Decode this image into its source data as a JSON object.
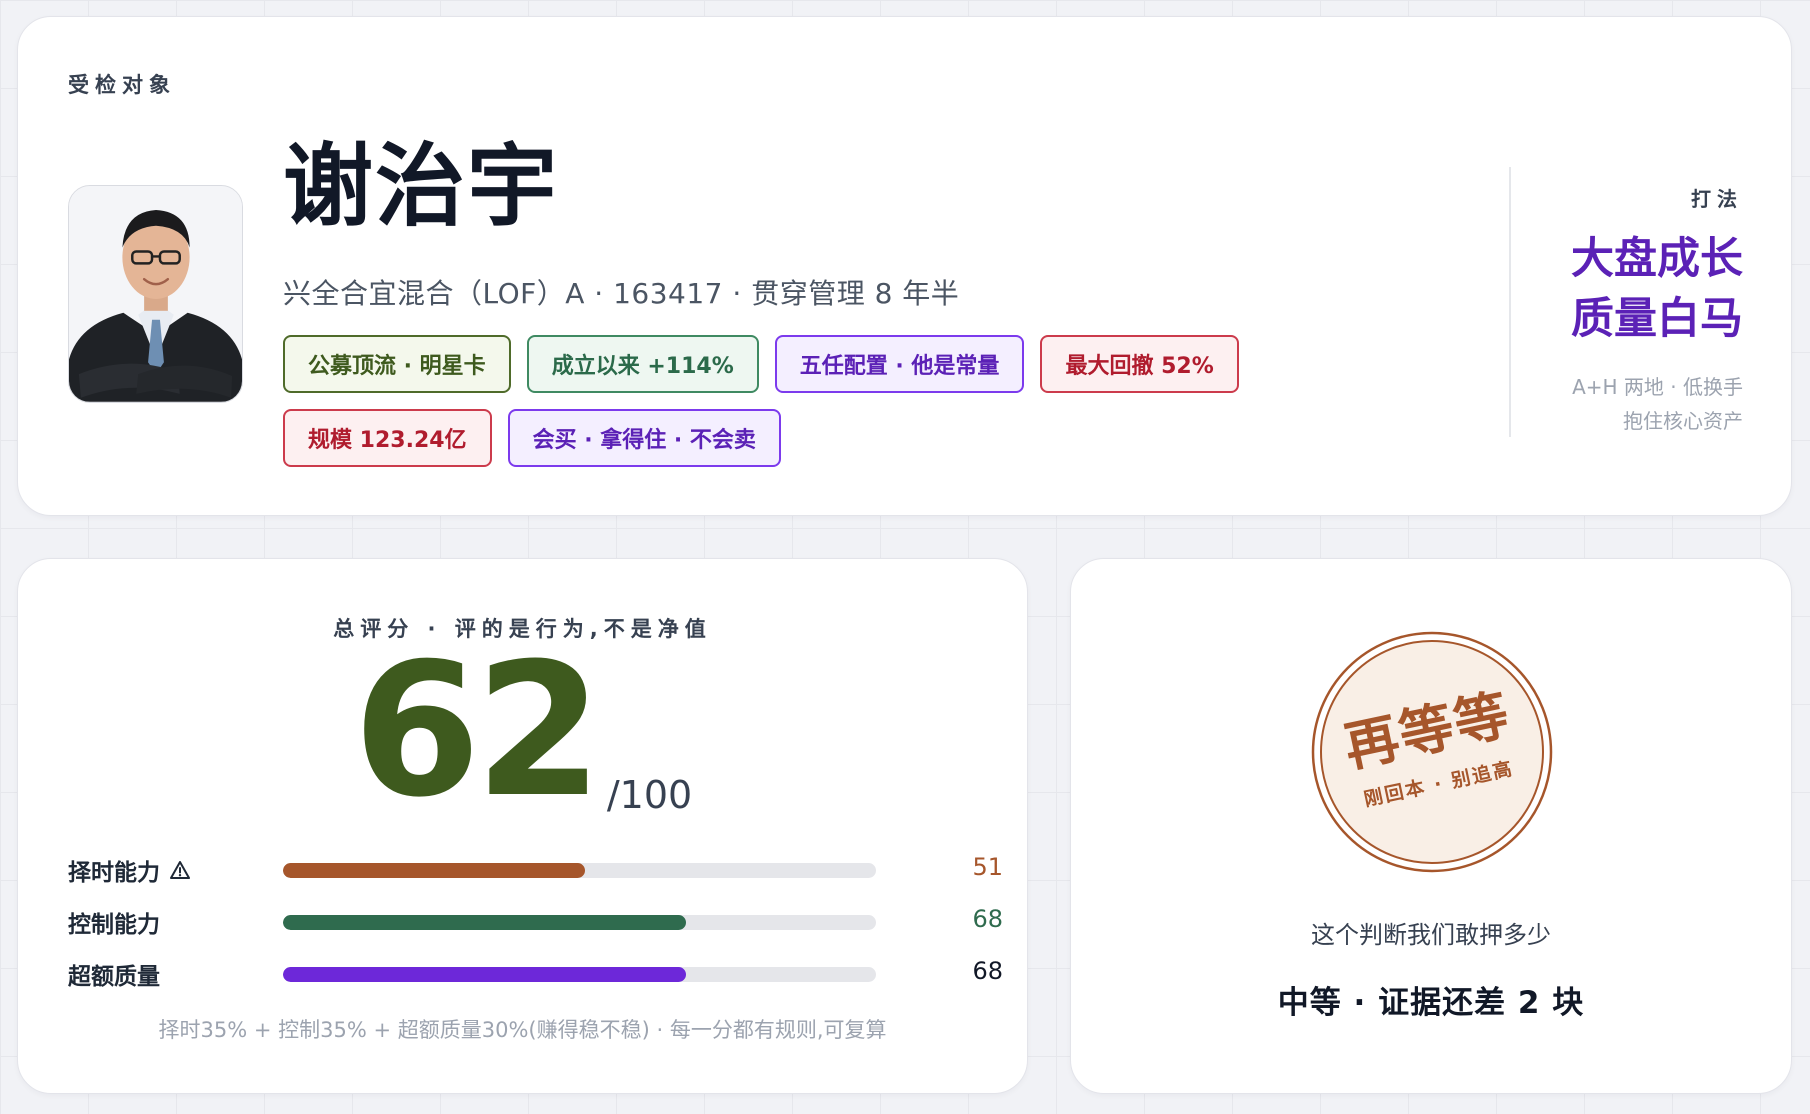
{
  "header": {
    "section_label": "受检对象",
    "name": "谢治宇",
    "fund_line": "兴全合宜混合（LOF）A · 163417 · 贯穿管理 8 年半",
    "avatar_icon": "manager-portrait",
    "tags": [
      {
        "label": "公募顶流 · 明星卡",
        "tone": "olive"
      },
      {
        "label": "成立以来 +114%",
        "tone": "green"
      },
      {
        "label": "五任配置 · 他是常量",
        "tone": "purple"
      },
      {
        "label": "最大回撤 52%",
        "tone": "red"
      },
      {
        "label": "规模 123.24亿",
        "tone": "red"
      },
      {
        "label": "会买 · 拿得住 · 不会卖",
        "tone": "purple"
      }
    ],
    "style": {
      "label": "打法",
      "title_line1": "大盘成长",
      "title_line2": "质量白马",
      "sub_line1": "A+H 两地 · 低换手",
      "sub_line2": "抱住核心资产"
    }
  },
  "score": {
    "caption": "总评分 · 评的是行为,不是净值",
    "value": "62",
    "max": "/100",
    "bars": [
      {
        "label": "择时能力",
        "value": 51,
        "display": "51",
        "color": "#a6562b",
        "value_color": "#a6562b",
        "warning": true
      },
      {
        "label": "控制能力",
        "value": 68,
        "display": "68",
        "color": "#2f6b4e",
        "value_color": "#2f6b4e",
        "warning": false
      },
      {
        "label": "超额质量",
        "value": 68,
        "display": "68",
        "color": "#6d28d9",
        "value_color": "#111827",
        "warning": false
      }
    ],
    "bar_max": 100,
    "footnote": "择时35% + 控制35% + 超额质量30%(赚得稳不稳) · 每一分都有规则,可复算"
  },
  "verdict": {
    "stamp_main": "再等等",
    "stamp_sub": "刚回本 · 别追高",
    "stamp_color": "#a6562b",
    "question": "这个判断我们敢押多少",
    "answer": "中等 · 证据还差 2 块"
  },
  "colors": {
    "accent_purple": "#5b21b6",
    "score_green": "#3e5a1e"
  }
}
